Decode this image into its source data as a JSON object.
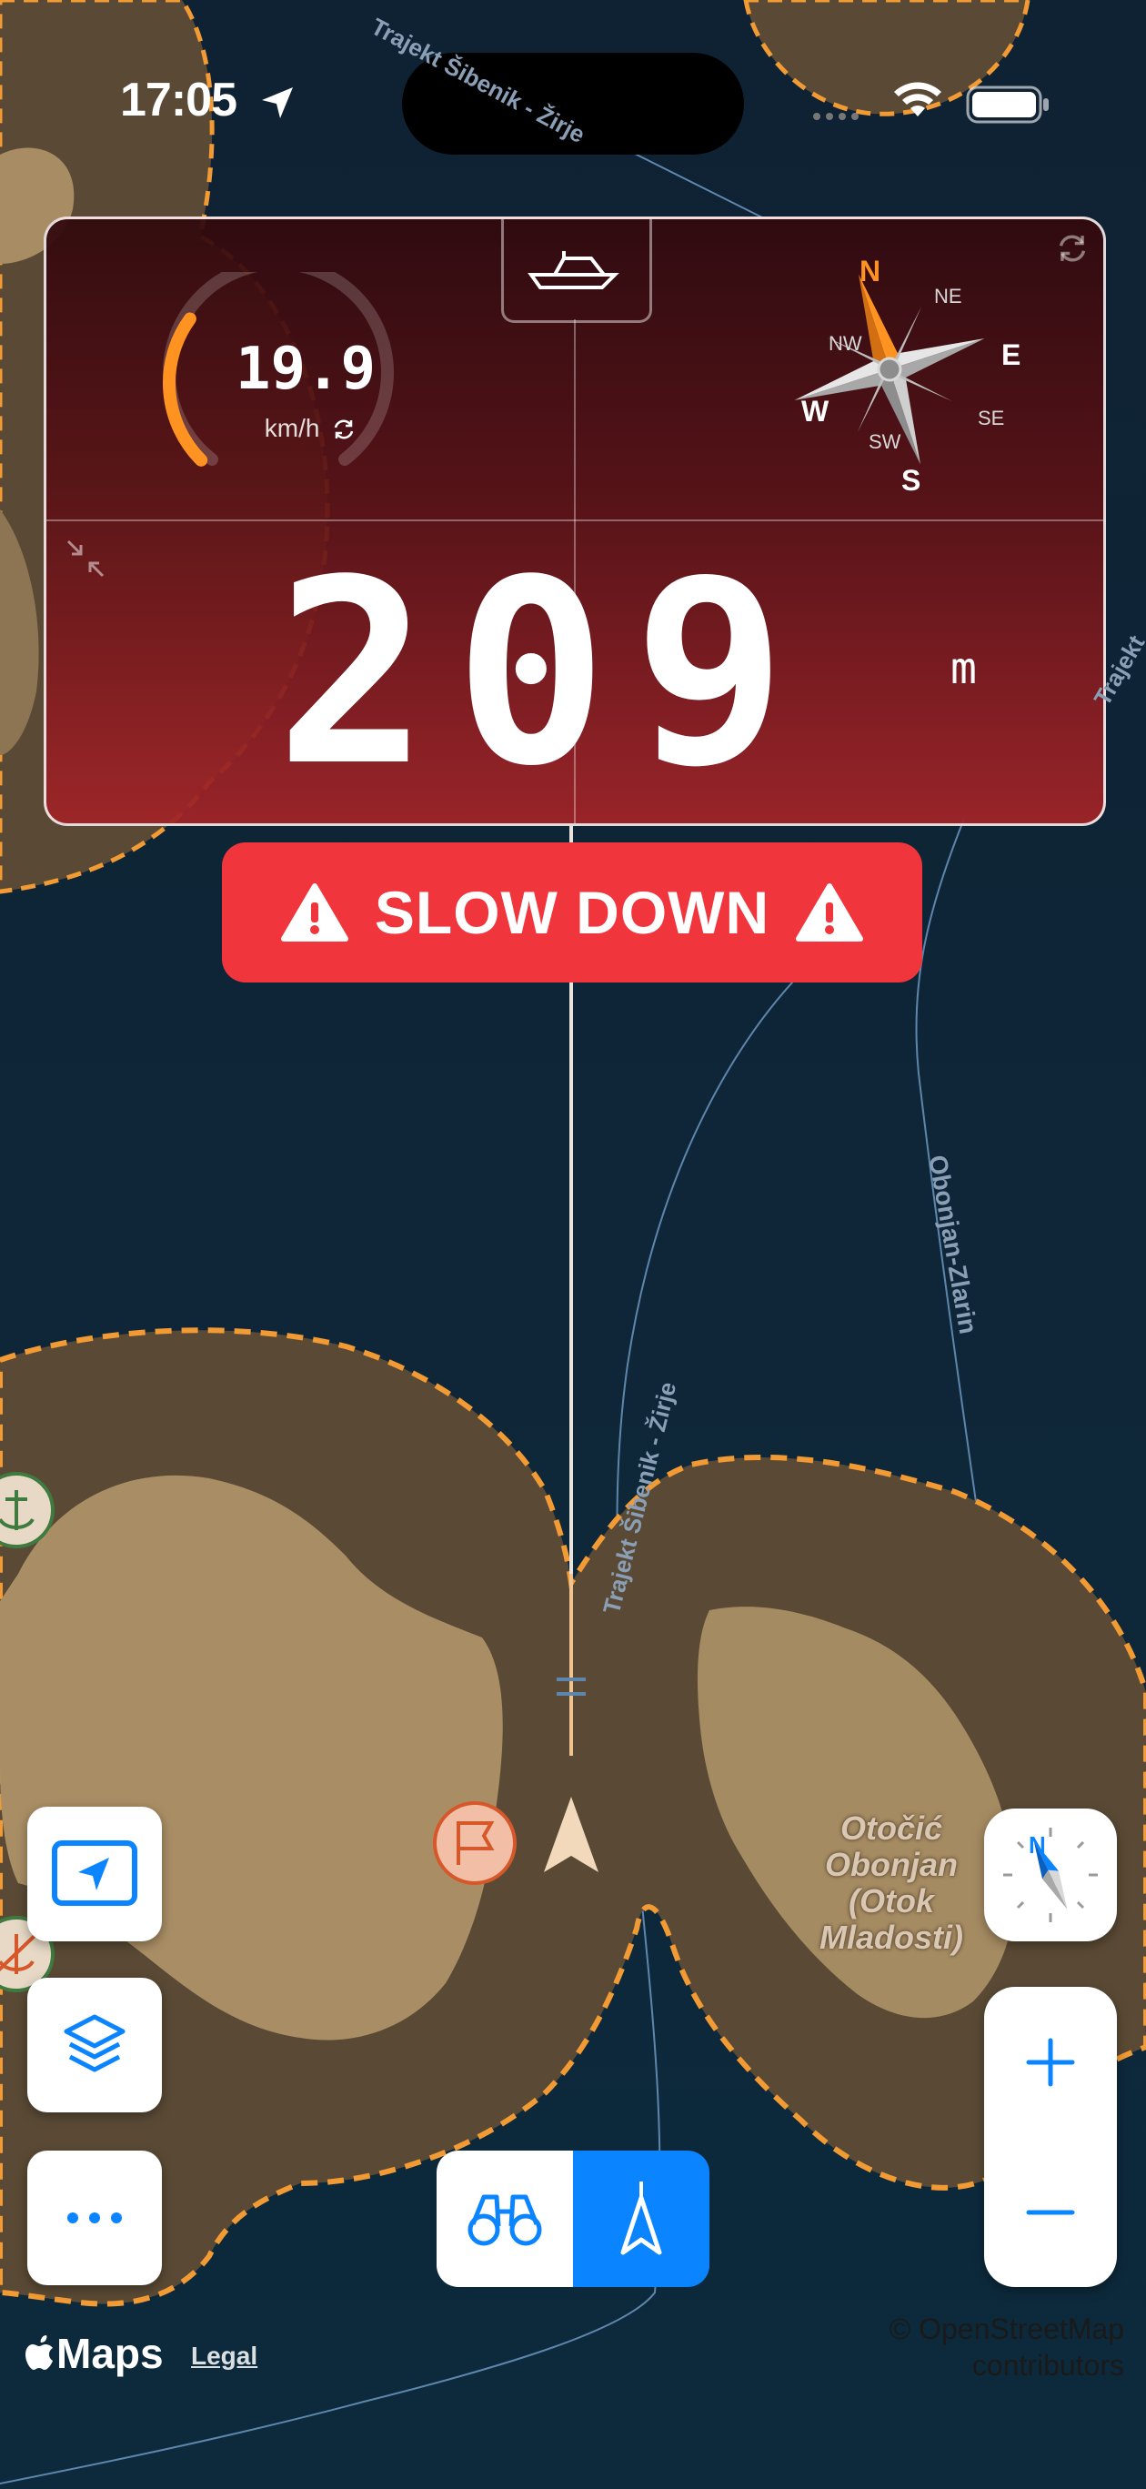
{
  "status_bar": {
    "time": "17:05"
  },
  "nav_panel": {
    "speed_value": "19.9",
    "speed_unit": "km/h",
    "speed_fraction": 0.3,
    "distance_value": "209",
    "distance_unit": "m",
    "compass": {
      "n": "N",
      "ne": "NE",
      "e": "E",
      "se": "SE",
      "s": "S",
      "sw": "SW",
      "w": "W",
      "nw": "NW"
    }
  },
  "warning": {
    "text": "SLOW DOWN"
  },
  "map_labels": {
    "route_top": "Trajekt Šibenik - Žirje",
    "route_main": "Trajekt Šibenik - Žirje",
    "route_right": "Obonjan-Zlarin",
    "route_edge": "Trajekt",
    "island_name": "Otočić Obonjan (Otok Mladosti)"
  },
  "attribution": {
    "line1": "© OpenStreetMap",
    "line2": "contributors"
  },
  "footer": {
    "maps_logo": "Maps",
    "legal": "Legal"
  },
  "colors": {
    "accent": "#0a84ff",
    "warning": "#f0353d",
    "speed_arc": "#ff9322",
    "buffer": "#f29a34"
  },
  "icons": [
    "location-arrow-icon",
    "wifi-icon",
    "battery-icon",
    "boat-icon",
    "sync-icon",
    "compass-rose-icon",
    "collapse-icon",
    "warning-triangle-icon",
    "navigate-screen-icon",
    "layers-icon",
    "more-icon",
    "binoculars-icon",
    "navigation-arrow-icon",
    "compass-icon",
    "plus-icon",
    "minus-icon",
    "flag-icon",
    "anchor-icon"
  ]
}
